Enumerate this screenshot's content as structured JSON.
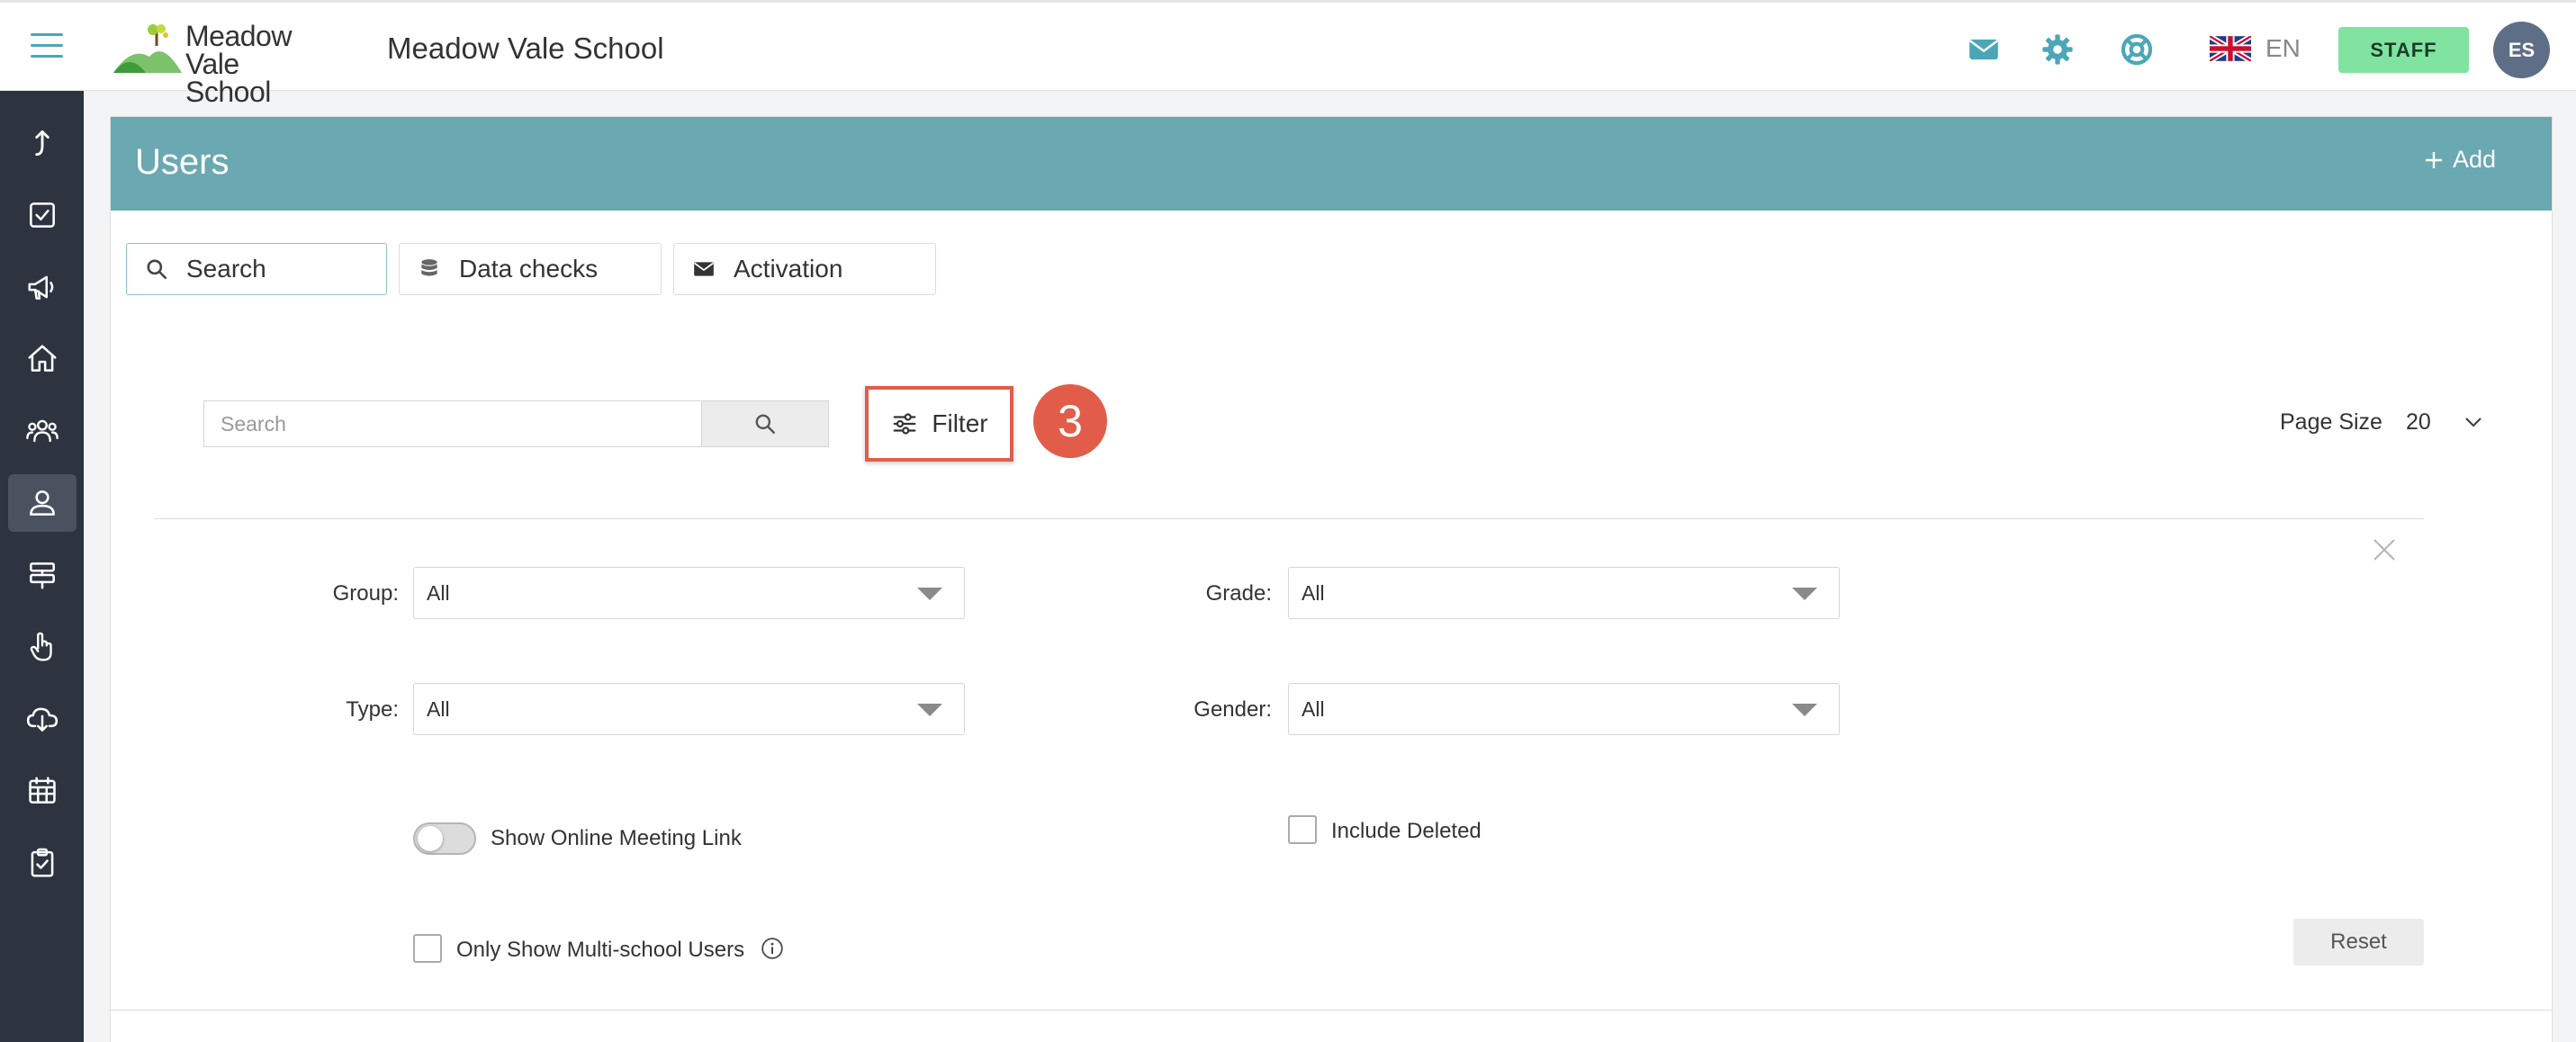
{
  "header": {
    "logo_text_line1": "Meadow",
    "logo_text_line2": "Vale School",
    "app_title": "Meadow Vale School",
    "language": "EN",
    "role_button": "STAFF",
    "avatar_initials": "ES",
    "icons": [
      "mail-icon",
      "gear-icon",
      "lifebuoy-icon",
      "uk-flag-icon"
    ]
  },
  "sidebar": {
    "items": [
      {
        "name": "upload-icon",
        "active": false
      },
      {
        "name": "checkbox-icon",
        "active": false
      },
      {
        "name": "megaphone-icon",
        "active": false
      },
      {
        "name": "home-icon",
        "active": false
      },
      {
        "name": "group-icon",
        "active": false
      },
      {
        "name": "user-icon",
        "active": true
      },
      {
        "name": "signpost-icon",
        "active": false
      },
      {
        "name": "hand-pointer-icon",
        "active": false
      },
      {
        "name": "cloud-download-icon",
        "active": false
      },
      {
        "name": "calendar-icon",
        "active": false
      },
      {
        "name": "clipboard-check-icon",
        "active": false
      }
    ]
  },
  "panel": {
    "title": "Users",
    "add_label": "Add",
    "tabs": [
      {
        "label": "Search",
        "icon": "search-icon",
        "active": true
      },
      {
        "label": "Data checks",
        "icon": "database-icon",
        "active": false
      },
      {
        "label": "Activation",
        "icon": "envelope-icon",
        "active": false
      }
    ]
  },
  "search": {
    "placeholder": "Search",
    "value": ""
  },
  "filter": {
    "label": "Filter",
    "step_number": "3"
  },
  "page_size": {
    "label": "Page Size",
    "value": "20"
  },
  "filters": {
    "group": {
      "label": "Group:",
      "value": "All"
    },
    "grade": {
      "label": "Grade:",
      "value": "All"
    },
    "type": {
      "label": "Type:",
      "value": "All"
    },
    "gender": {
      "label": "Gender:",
      "value": "All"
    },
    "show_online_meeting_link": {
      "label": "Show Online Meeting Link",
      "enabled": false
    },
    "include_deleted": {
      "label": "Include Deleted",
      "checked": false
    },
    "only_multi_school": {
      "label": "Only Show Multi-school Users",
      "checked": false
    },
    "reset_label": "Reset"
  },
  "colors": {
    "accent": "#4ba7b8",
    "panel_header": "#6aa8b2",
    "sidebar": "#2d3440",
    "staff_button": "#80e4a0",
    "highlight": "#e15d4a"
  }
}
